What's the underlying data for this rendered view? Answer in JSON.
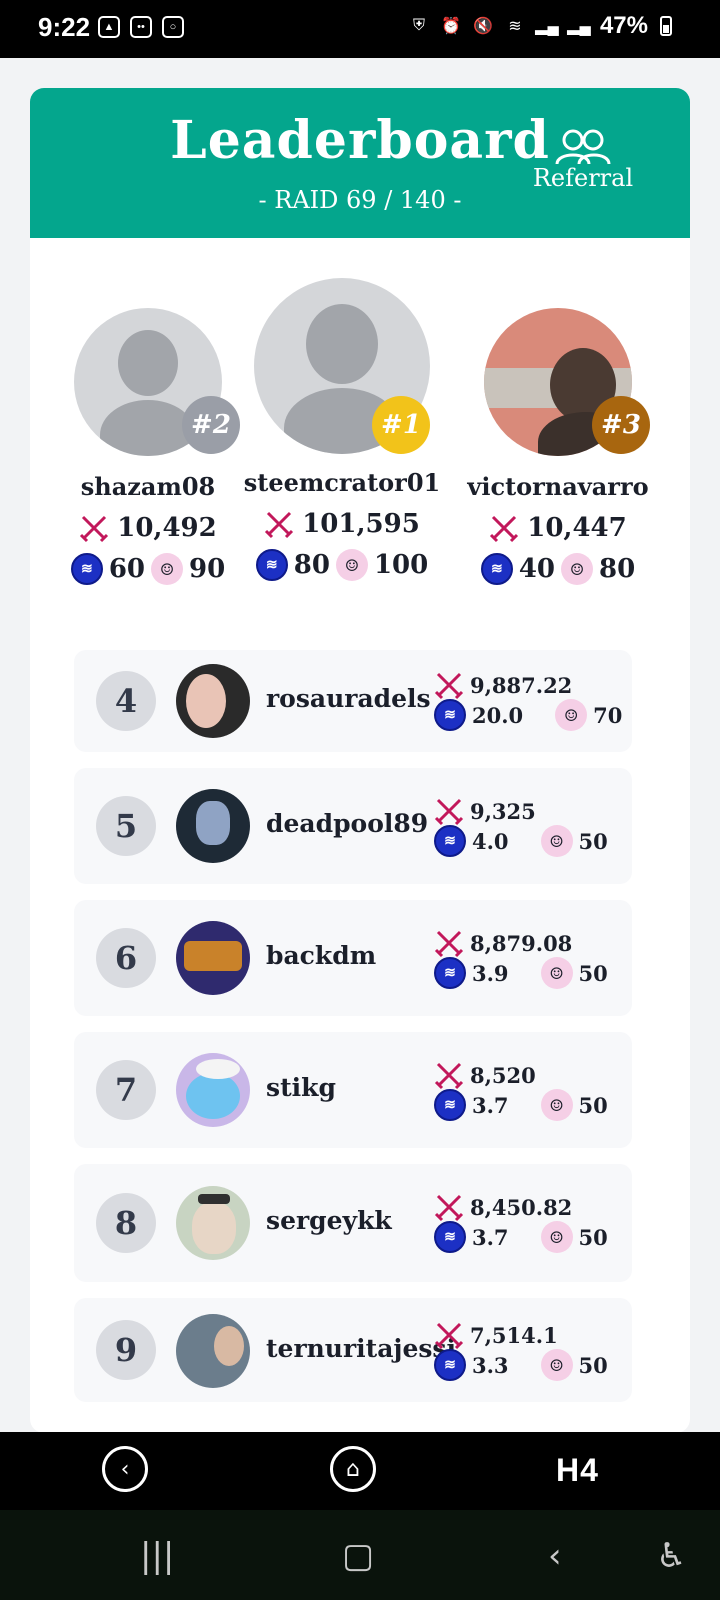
{
  "status_bar": {
    "time": "9:22",
    "battery": "47%",
    "left_icons": [
      "gallery-icon",
      "discord-icon",
      "instagram-icon"
    ],
    "right_icons": [
      "shield-icon",
      "alarm-icon",
      "mute-icon",
      "wifi-icon",
      "signal-icon",
      "signal-icon"
    ]
  },
  "header": {
    "title": "Leaderboard",
    "subtitle": "- RAID 69 / 140 -",
    "referral_label": "Referral",
    "background_color": "#04a68d"
  },
  "podium": [
    {
      "rank": "#2",
      "name": "shazam08",
      "score": "10,492",
      "steem": "60",
      "token": "90",
      "badge_color": "#9a9ea7"
    },
    {
      "rank": "#1",
      "name": "steemcrator01",
      "score": "101,595",
      "steem": "80",
      "token": "100",
      "badge_color": "#f2c31a"
    },
    {
      "rank": "#3",
      "name": "victornavarro",
      "score": "10,447",
      "steem": "40",
      "token": "80",
      "badge_color": "#a8660f"
    }
  ],
  "leaderboard": [
    {
      "rank": "4",
      "name": "rosauradels",
      "score": "9,887.22",
      "steem": "20.0",
      "token": "70"
    },
    {
      "rank": "5",
      "name": "deadpool89",
      "score": "9,325",
      "steem": "4.0",
      "token": "50"
    },
    {
      "rank": "6",
      "name": "backdm",
      "score": "8,879.08",
      "steem": "3.9",
      "token": "50"
    },
    {
      "rank": "7",
      "name": "stikg",
      "score": "8,520",
      "steem": "3.7",
      "token": "50"
    },
    {
      "rank": "8",
      "name": "sergeykk",
      "score": "8,450.82",
      "steem": "3.7",
      "token": "50"
    },
    {
      "rank": "9",
      "name": "ternuritajessi",
      "score": "7,514.1",
      "steem": "3.3",
      "token": "50"
    }
  ],
  "app_nav": {
    "logo_text": "H4",
    "items": [
      "back-icon",
      "home-icon"
    ]
  },
  "system_nav": [
    "recents-icon",
    "home-icon",
    "back-icon",
    "accessibility-icon"
  ]
}
